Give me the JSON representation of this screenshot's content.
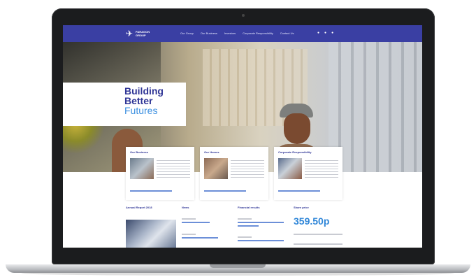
{
  "nav": {
    "logo_text": "PARAGON\nGROUP",
    "links": [
      "Our Group",
      "Our Business",
      "Investors",
      "Corporate Responsibility",
      "Contact Us"
    ],
    "icons": [
      "search-icon",
      "phone-icon",
      "menu-icon"
    ]
  },
  "hero": {
    "title_line1": "Building",
    "title_line2": "Better",
    "title_line3": "Futures"
  },
  "cards": [
    {
      "title": "Our Business"
    },
    {
      "title": "Our Homes"
    },
    {
      "title": "Corporate Responsibility"
    }
  ],
  "sections": {
    "report": "Annual Report 2018",
    "news": "News",
    "results": "Financial results",
    "share": "Share price"
  },
  "share_price": "359.50p",
  "colors": {
    "brand": "#3a3fa3",
    "accent": "#3b8fe0"
  }
}
